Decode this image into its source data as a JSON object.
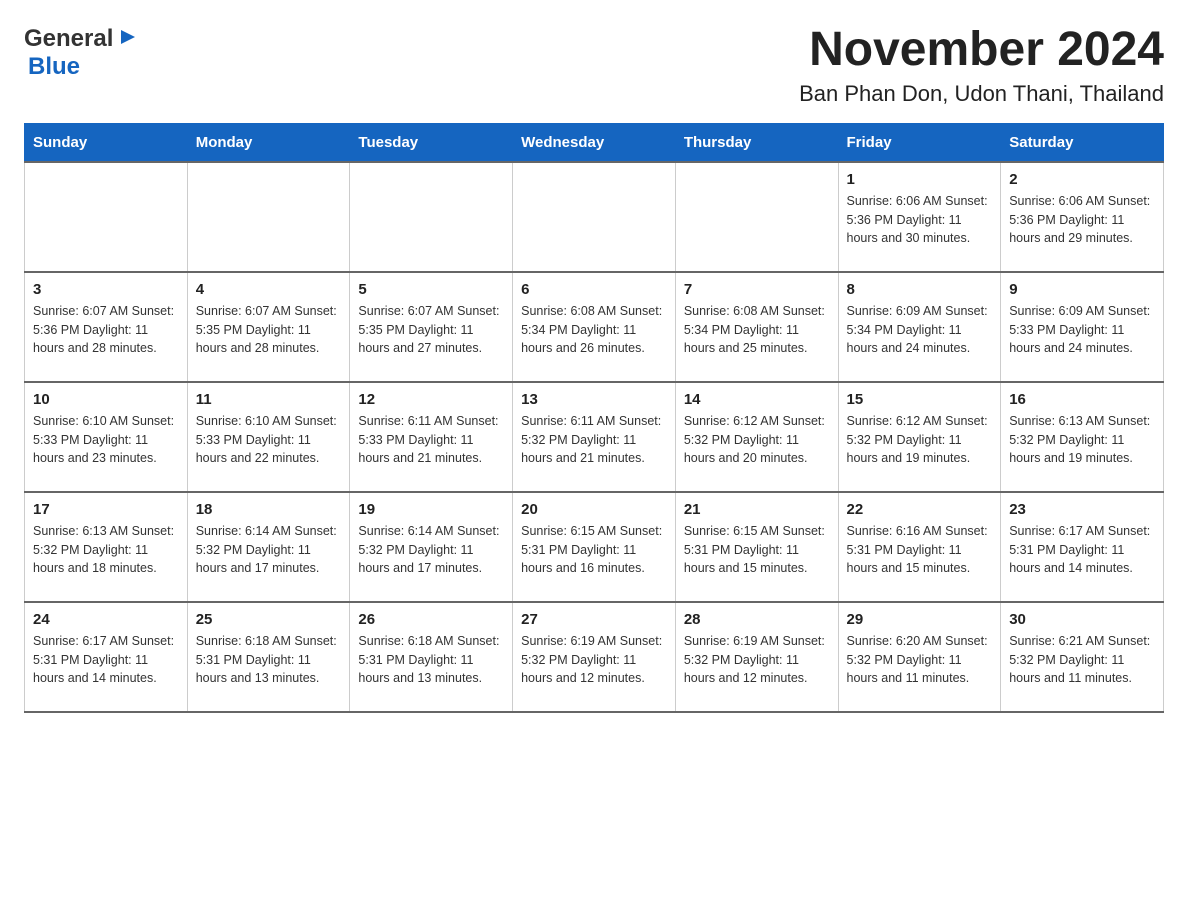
{
  "header": {
    "logo_general": "General",
    "logo_blue": "Blue",
    "month_title": "November 2024",
    "location": "Ban Phan Don, Udon Thani, Thailand"
  },
  "weekdays": [
    "Sunday",
    "Monday",
    "Tuesday",
    "Wednesday",
    "Thursday",
    "Friday",
    "Saturday"
  ],
  "weeks": [
    [
      {
        "day": "",
        "info": ""
      },
      {
        "day": "",
        "info": ""
      },
      {
        "day": "",
        "info": ""
      },
      {
        "day": "",
        "info": ""
      },
      {
        "day": "",
        "info": ""
      },
      {
        "day": "1",
        "info": "Sunrise: 6:06 AM\nSunset: 5:36 PM\nDaylight: 11 hours and 30 minutes."
      },
      {
        "day": "2",
        "info": "Sunrise: 6:06 AM\nSunset: 5:36 PM\nDaylight: 11 hours and 29 minutes."
      }
    ],
    [
      {
        "day": "3",
        "info": "Sunrise: 6:07 AM\nSunset: 5:36 PM\nDaylight: 11 hours and 28 minutes."
      },
      {
        "day": "4",
        "info": "Sunrise: 6:07 AM\nSunset: 5:35 PM\nDaylight: 11 hours and 28 minutes."
      },
      {
        "day": "5",
        "info": "Sunrise: 6:07 AM\nSunset: 5:35 PM\nDaylight: 11 hours and 27 minutes."
      },
      {
        "day": "6",
        "info": "Sunrise: 6:08 AM\nSunset: 5:34 PM\nDaylight: 11 hours and 26 minutes."
      },
      {
        "day": "7",
        "info": "Sunrise: 6:08 AM\nSunset: 5:34 PM\nDaylight: 11 hours and 25 minutes."
      },
      {
        "day": "8",
        "info": "Sunrise: 6:09 AM\nSunset: 5:34 PM\nDaylight: 11 hours and 24 minutes."
      },
      {
        "day": "9",
        "info": "Sunrise: 6:09 AM\nSunset: 5:33 PM\nDaylight: 11 hours and 24 minutes."
      }
    ],
    [
      {
        "day": "10",
        "info": "Sunrise: 6:10 AM\nSunset: 5:33 PM\nDaylight: 11 hours and 23 minutes."
      },
      {
        "day": "11",
        "info": "Sunrise: 6:10 AM\nSunset: 5:33 PM\nDaylight: 11 hours and 22 minutes."
      },
      {
        "day": "12",
        "info": "Sunrise: 6:11 AM\nSunset: 5:33 PM\nDaylight: 11 hours and 21 minutes."
      },
      {
        "day": "13",
        "info": "Sunrise: 6:11 AM\nSunset: 5:32 PM\nDaylight: 11 hours and 21 minutes."
      },
      {
        "day": "14",
        "info": "Sunrise: 6:12 AM\nSunset: 5:32 PM\nDaylight: 11 hours and 20 minutes."
      },
      {
        "day": "15",
        "info": "Sunrise: 6:12 AM\nSunset: 5:32 PM\nDaylight: 11 hours and 19 minutes."
      },
      {
        "day": "16",
        "info": "Sunrise: 6:13 AM\nSunset: 5:32 PM\nDaylight: 11 hours and 19 minutes."
      }
    ],
    [
      {
        "day": "17",
        "info": "Sunrise: 6:13 AM\nSunset: 5:32 PM\nDaylight: 11 hours and 18 minutes."
      },
      {
        "day": "18",
        "info": "Sunrise: 6:14 AM\nSunset: 5:32 PM\nDaylight: 11 hours and 17 minutes."
      },
      {
        "day": "19",
        "info": "Sunrise: 6:14 AM\nSunset: 5:32 PM\nDaylight: 11 hours and 17 minutes."
      },
      {
        "day": "20",
        "info": "Sunrise: 6:15 AM\nSunset: 5:31 PM\nDaylight: 11 hours and 16 minutes."
      },
      {
        "day": "21",
        "info": "Sunrise: 6:15 AM\nSunset: 5:31 PM\nDaylight: 11 hours and 15 minutes."
      },
      {
        "day": "22",
        "info": "Sunrise: 6:16 AM\nSunset: 5:31 PM\nDaylight: 11 hours and 15 minutes."
      },
      {
        "day": "23",
        "info": "Sunrise: 6:17 AM\nSunset: 5:31 PM\nDaylight: 11 hours and 14 minutes."
      }
    ],
    [
      {
        "day": "24",
        "info": "Sunrise: 6:17 AM\nSunset: 5:31 PM\nDaylight: 11 hours and 14 minutes."
      },
      {
        "day": "25",
        "info": "Sunrise: 6:18 AM\nSunset: 5:31 PM\nDaylight: 11 hours and 13 minutes."
      },
      {
        "day": "26",
        "info": "Sunrise: 6:18 AM\nSunset: 5:31 PM\nDaylight: 11 hours and 13 minutes."
      },
      {
        "day": "27",
        "info": "Sunrise: 6:19 AM\nSunset: 5:32 PM\nDaylight: 11 hours and 12 minutes."
      },
      {
        "day": "28",
        "info": "Sunrise: 6:19 AM\nSunset: 5:32 PM\nDaylight: 11 hours and 12 minutes."
      },
      {
        "day": "29",
        "info": "Sunrise: 6:20 AM\nSunset: 5:32 PM\nDaylight: 11 hours and 11 minutes."
      },
      {
        "day": "30",
        "info": "Sunrise: 6:21 AM\nSunset: 5:32 PM\nDaylight: 11 hours and 11 minutes."
      }
    ]
  ]
}
